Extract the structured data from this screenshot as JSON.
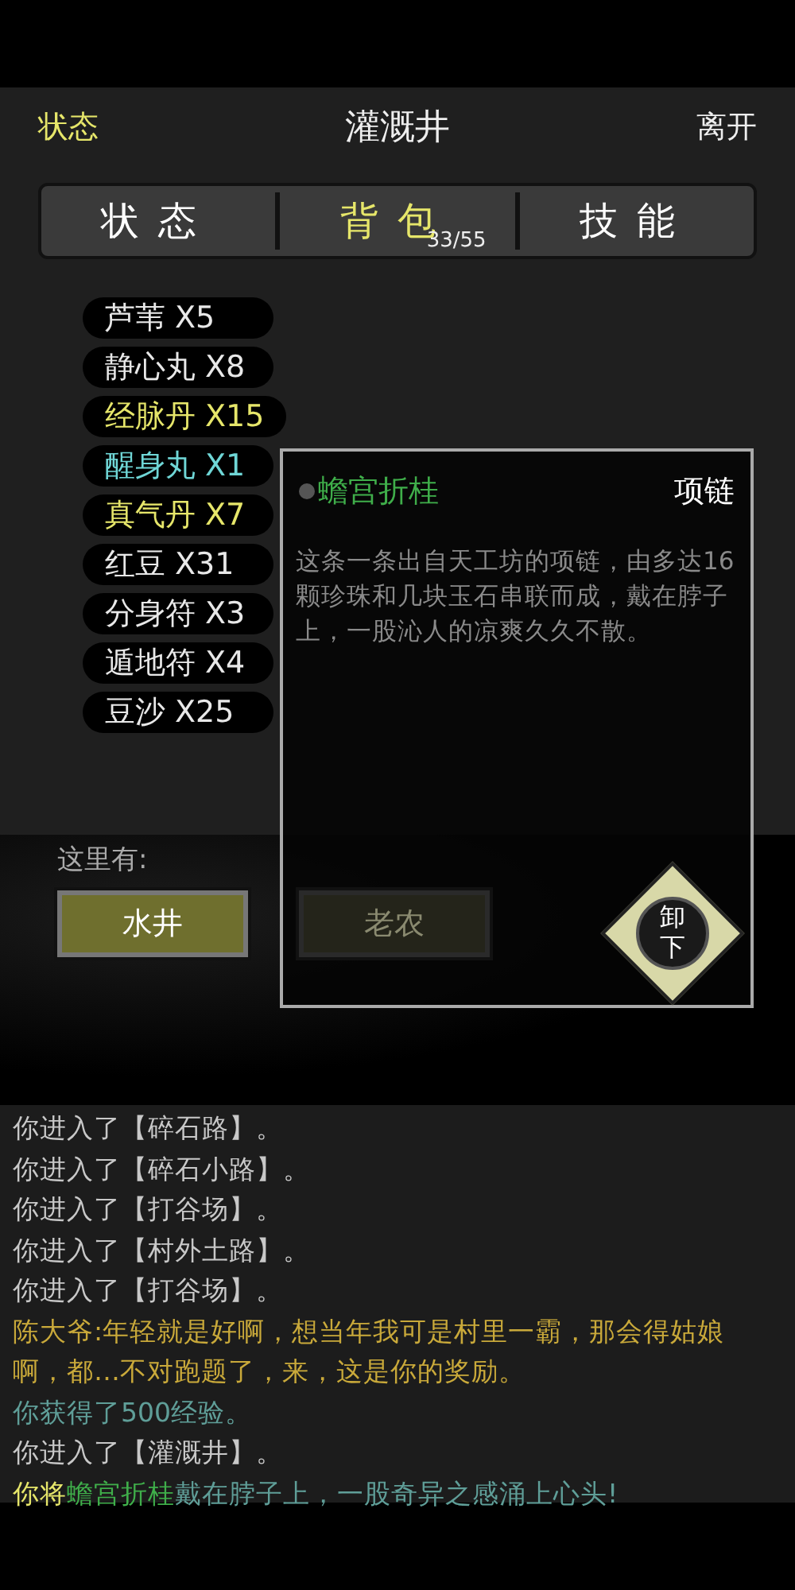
{
  "header": {
    "left": "状态",
    "title": "灌溉井",
    "right": "离开"
  },
  "tabs": [
    {
      "label": "状态",
      "selected": false
    },
    {
      "label": "背包",
      "selected": true,
      "count": "33/55"
    },
    {
      "label": "技能",
      "selected": false
    }
  ],
  "inventory": [
    {
      "label": "芦苇 X5",
      "color": "#e8e8e8"
    },
    {
      "label": "静心丸 X8",
      "color": "#e8e8e8"
    },
    {
      "label": "经脉丹 X15",
      "color": "#e6e66a"
    },
    {
      "label": "醒身丸 X1",
      "color": "#6fd6d6"
    },
    {
      "label": "真气丹 X7",
      "color": "#e6e66a"
    },
    {
      "label": "红豆 X31",
      "color": "#e8e8e8"
    },
    {
      "label": "分身符 X3",
      "color": "#e8e8e8"
    },
    {
      "label": "遁地符 X4",
      "color": "#e8e8e8"
    },
    {
      "label": "豆沙 X25",
      "color": "#e8e8e8"
    }
  ],
  "here": {
    "label": "这里有:",
    "buttons": [
      {
        "label": "水井",
        "selected": true
      },
      {
        "label": "老农",
        "selected": false
      }
    ]
  },
  "popup": {
    "name": "蟾宫折桂",
    "type": "项链",
    "description": "这条一条出自天工坊的项链，由多达16颗珍珠和几块玉石串联而成，戴在脖子上，一股沁人的凉爽久久不散。",
    "action": "卸下"
  },
  "log": [
    [
      {
        "text": "你进入了【碎石路】。",
        "color": "#c8c8c8"
      }
    ],
    [
      {
        "text": "你进入了【碎石小路】。",
        "color": "#c8c8c8"
      }
    ],
    [
      {
        "text": "你进入了【打谷场】。",
        "color": "#c8c8c8"
      }
    ],
    [
      {
        "text": "你进入了【村外土路】。",
        "color": "#c8c8c8"
      }
    ],
    [
      {
        "text": "你进入了【打谷场】。",
        "color": "#c8c8c8"
      }
    ],
    [
      {
        "text": "陈大爷:年轻就是好啊，想当年我可是村里一霸，那会得姑娘啊，都…不对跑题了，来，这是你的奖励。",
        "color": "#c9a93a"
      }
    ],
    [
      {
        "text": "你获得了500经验。",
        "color": "#5f9e98"
      }
    ],
    [
      {
        "text": "你进入了【灌溉井】。",
        "color": "#c8c8c8"
      }
    ],
    [
      {
        "text": "你将",
        "color": "#e6e66a"
      },
      {
        "text": "蟾宫折桂",
        "color": "#3fae4a"
      },
      {
        "text": "戴在脖子上，一股奇异之感涌上心头!",
        "color": "#5f9e98"
      }
    ]
  ]
}
